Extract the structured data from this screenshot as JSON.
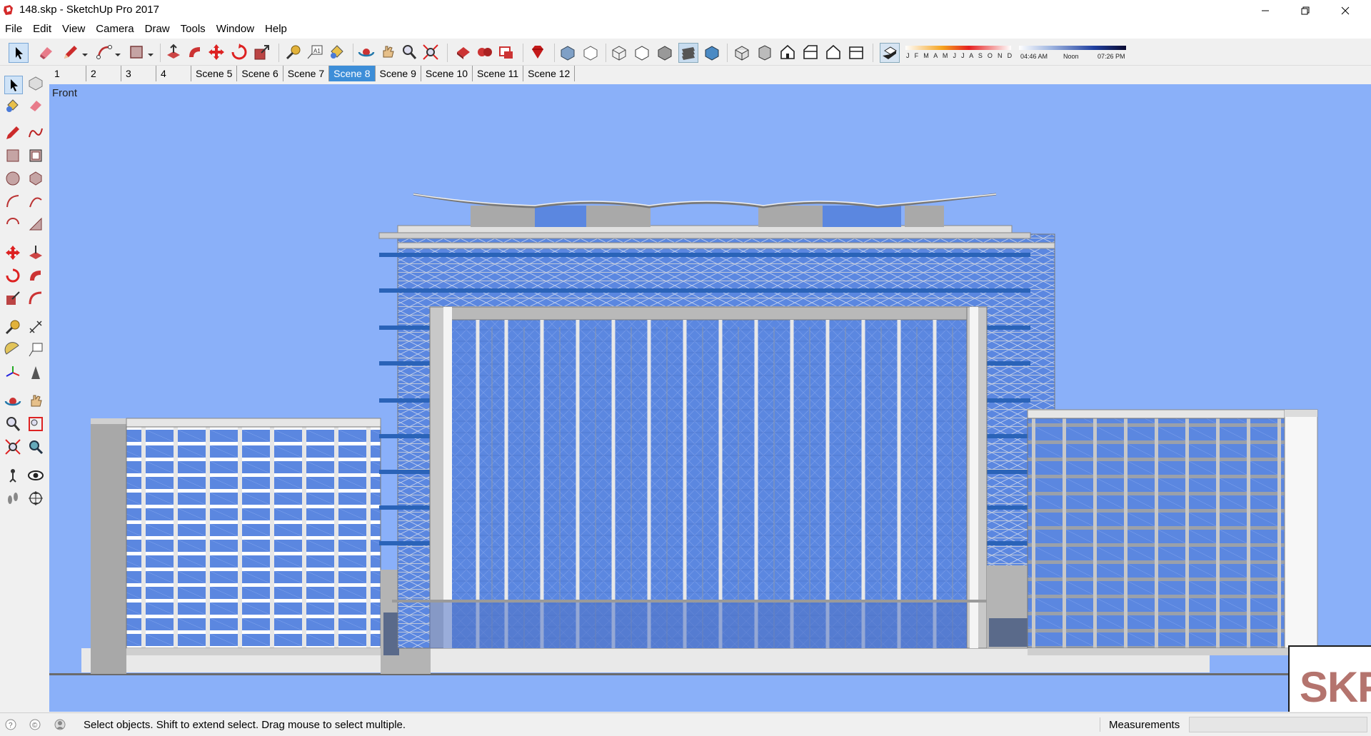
{
  "window": {
    "title": "148.skp - SketchUp Pro 2017",
    "minimize_icon": "minimize-icon",
    "maximize_icon": "restore-icon",
    "close_icon": "close-icon"
  },
  "menu": {
    "items": [
      "File",
      "Edit",
      "View",
      "Camera",
      "Draw",
      "Tools",
      "Window",
      "Help"
    ]
  },
  "toolbar": {
    "icons": [
      "select-icon",
      "eraser-icon",
      "pencil-icon",
      "arc-icon",
      "rectangle-icon",
      "push-pull-icon",
      "follow-me-icon",
      "move-icon",
      "rotate-icon",
      "scale-icon",
      "tape-measure-icon",
      "text-icon",
      "paint-bucket-icon",
      "orbit-icon",
      "pan-icon",
      "zoom-icon",
      "zoom-extents-icon",
      "warehouse-icon",
      "extension-warehouse-icon",
      "layout-icon",
      "ruby-icon",
      "xray-icon",
      "back-edges-icon",
      "wireframe-icon",
      "hidden-line-icon",
      "shaded-icon",
      "shaded-textures-icon",
      "monochrome-icon",
      "iso-view-icon",
      "top-view-icon",
      "front-view-icon",
      "right-view-icon",
      "back-view-icon",
      "left-view-icon",
      "shadows-icon"
    ],
    "shadow_months": "J F M A M J J A S O N D",
    "shadow_time_start": "04:46 AM",
    "shadow_time_mid": "Noon",
    "shadow_time_end": "07:26 PM"
  },
  "scenes": {
    "tabs": [
      "1",
      "2",
      "3",
      "4",
      "Scene 5",
      "Scene 6",
      "Scene 7",
      "Scene 8",
      "Scene 9",
      "Scene 10",
      "Scene 11",
      "Scene 12"
    ],
    "active": "Scene 8"
  },
  "viewport": {
    "view_name": "Front",
    "background_color": "#8ab0f9",
    "logo_text": "SKP"
  },
  "status": {
    "message": "Select objects. Shift to extend select. Drag mouse to select multiple.",
    "measurements_label": "Measurements",
    "measurements_value": ""
  },
  "colors": {
    "accent": "#3d8ed8",
    "glass": "#5b87e0",
    "structure": "#c8c8c8"
  }
}
